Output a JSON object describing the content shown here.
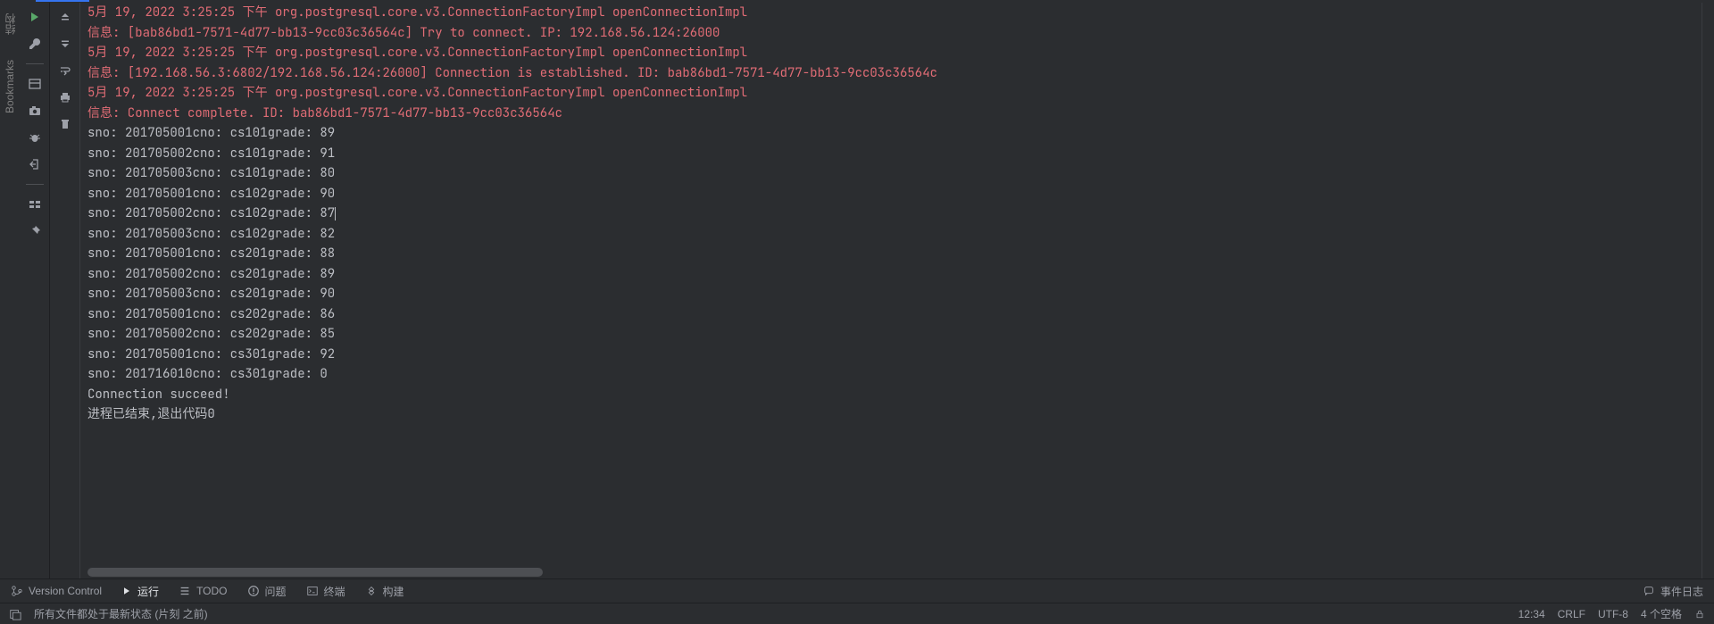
{
  "left_panel": {
    "structure_label": "结构",
    "bookmarks_label": "Bookmarks"
  },
  "console": {
    "log_lines": [
      {
        "cls": "red",
        "text": "5月 19, 2022 3:25:25 下午 org.postgresql.core.v3.ConnectionFactoryImpl openConnectionImpl"
      },
      {
        "cls": "red",
        "text": "信息: [bab86bd1-7571-4d77-bb13-9cc03c36564c] Try to connect. IP: 192.168.56.124:26000"
      },
      {
        "cls": "red",
        "text": "5月 19, 2022 3:25:25 下午 org.postgresql.core.v3.ConnectionFactoryImpl openConnectionImpl"
      },
      {
        "cls": "red",
        "text": "信息: [192.168.56.3:6802/192.168.56.124:26000] Connection is established. ID: bab86bd1-7571-4d77-bb13-9cc03c36564c"
      },
      {
        "cls": "red",
        "text": "5月 19, 2022 3:25:25 下午 org.postgresql.core.v3.ConnectionFactoryImpl openConnectionImpl"
      },
      {
        "cls": "red",
        "text": "信息: Connect complete. ID: bab86bd1-7571-4d77-bb13-9cc03c36564c"
      },
      {
        "cls": "gray",
        "text": "sno: 201705001cno: cs101grade: 89"
      },
      {
        "cls": "gray",
        "text": "sno: 201705002cno: cs101grade: 91"
      },
      {
        "cls": "gray",
        "text": "sno: 201705003cno: cs101grade: 80"
      },
      {
        "cls": "gray",
        "text": "sno: 201705001cno: cs102grade: 90"
      },
      {
        "cls": "gray",
        "text": "sno: 201705002cno: cs102grade: 87"
      },
      {
        "cls": "gray",
        "text": "sno: 201705003cno: cs102grade: 82"
      },
      {
        "cls": "gray",
        "text": "sno: 201705001cno: cs201grade: 88"
      },
      {
        "cls": "gray",
        "text": "sno: 201705002cno: cs201grade: 89"
      },
      {
        "cls": "gray",
        "text": "sno: 201705003cno: cs201grade: 90"
      },
      {
        "cls": "gray",
        "text": "sno: 201705001cno: cs202grade: 86"
      },
      {
        "cls": "gray",
        "text": "sno: 201705002cno: cs202grade: 85"
      },
      {
        "cls": "gray",
        "text": "sno: 201705001cno: cs301grade: 92"
      },
      {
        "cls": "gray",
        "text": "sno: 201716010cno: cs301grade: 0"
      },
      {
        "cls": "gray",
        "text": "Connection succeed!"
      },
      {
        "cls": "gray",
        "text": ""
      },
      {
        "cls": "gray",
        "text": "进程已结束,退出代码0"
      }
    ],
    "caret_line_index": 10
  },
  "bottom_tabs": {
    "version_control": "Version Control",
    "run": "运行",
    "todo": "TODO",
    "problems": "问题",
    "terminal": "终端",
    "build": "构建",
    "event_log": "事件日志"
  },
  "status_bar": {
    "vcs_status": "所有文件都处于最新状态 (片刻 之前)",
    "cursor": "12:34",
    "line_sep": "CRLF",
    "encoding": "UTF-8",
    "indent": "4 个空格"
  }
}
